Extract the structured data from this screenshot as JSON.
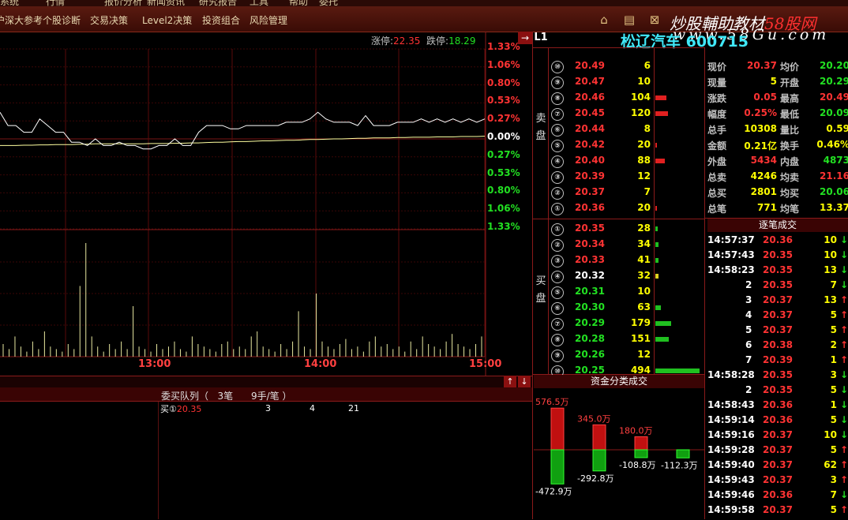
{
  "menu_top": [
    "系统",
    "行情",
    "报价分析",
    "新闻资讯",
    "研究报告",
    "工具",
    "帮助",
    "委托"
  ],
  "menu": [
    "沪深大参考",
    "个股诊断",
    "交易决策",
    "Level2决策",
    "投资组合",
    "风险管理"
  ],
  "watermark": {
    "text_a": "炒股輔助教材",
    "text_b": "58股网",
    "url": "www.58Gu.com"
  },
  "stock_name": "松辽汽车 600715",
  "limits": {
    "up_label": "涨停:",
    "up": "22.35",
    "down_label": "跌停:",
    "down": "18.29"
  },
  "buttons": {
    "arrow": "→",
    "l1": "L1",
    "up": "↑",
    "down": "↓"
  },
  "pct_axis": [
    {
      "v": "1.33%",
      "c": "r"
    },
    {
      "v": "1.06%",
      "c": "r"
    },
    {
      "v": "0.80%",
      "c": "r"
    },
    {
      "v": "0.53%",
      "c": "r"
    },
    {
      "v": "0.27%",
      "c": "r"
    },
    {
      "v": "0.00%",
      "c": "w"
    },
    {
      "v": "0.27%",
      "c": "g"
    },
    {
      "v": "0.53%",
      "c": "g"
    },
    {
      "v": "0.80%",
      "c": "g"
    },
    {
      "v": "1.06%",
      "c": "g"
    },
    {
      "v": "1.33%",
      "c": "g"
    }
  ],
  "time_labels": [
    "13:00",
    "14:00",
    "15:00"
  ],
  "intraday_chart": {
    "price": [
      20.4,
      20.36,
      20.36,
      20.34,
      20.34,
      20.38,
      20.36,
      20.34,
      20.34,
      20.31,
      20.31,
      20.3,
      20.32,
      20.3,
      20.3,
      20.31,
      20.3,
      20.3,
      20.29,
      20.29,
      20.3,
      20.3,
      20.32,
      20.3,
      20.3,
      20.34,
      20.36,
      20.36,
      20.36,
      20.35,
      20.35,
      20.36,
      20.36,
      20.36,
      20.36,
      20.36,
      20.37,
      20.37,
      20.37,
      20.38,
      20.4,
      20.38,
      20.37,
      20.37,
      20.37,
      20.36,
      20.39,
      20.36,
      20.36,
      20.36,
      20.37,
      20.37,
      20.37,
      20.38,
      20.37,
      20.38,
      20.37,
      20.38,
      20.37,
      20.38,
      20.37,
      20.38
    ],
    "avg": [
      20.3,
      20.3,
      20.3,
      20.301,
      20.301,
      20.302,
      20.302,
      20.303,
      20.303,
      20.303,
      20.304,
      20.304,
      20.305,
      20.305,
      20.305,
      20.305,
      20.305,
      20.305,
      20.305,
      20.306,
      20.306,
      20.306,
      20.307,
      20.307,
      20.308,
      20.308,
      20.309,
      20.31,
      20.31,
      20.311,
      20.312,
      20.312,
      20.313,
      20.314,
      20.314,
      20.315,
      20.316,
      20.316,
      20.317,
      20.318,
      20.318,
      20.319,
      20.32,
      20.32,
      20.321,
      20.322,
      20.322,
      20.323,
      20.323,
      20.323,
      20.324,
      20.324,
      20.325,
      20.325,
      20.325,
      20.326,
      20.326,
      20.326,
      20.327,
      20.327,
      20.327,
      20.328
    ],
    "volume": [
      5,
      3,
      8,
      4,
      2,
      6,
      3,
      10,
      4,
      3,
      2,
      5,
      3,
      28,
      45,
      8,
      4,
      2,
      5,
      3,
      6,
      3,
      20,
      4,
      3,
      2,
      5,
      3,
      4,
      6,
      3,
      2,
      8,
      5,
      4,
      3,
      2,
      5,
      6,
      3,
      4,
      3,
      8,
      10,
      4,
      3,
      2,
      5,
      3,
      6,
      18,
      4,
      3,
      25,
      6,
      4,
      3,
      5,
      7,
      3,
      4,
      2,
      6,
      8,
      4,
      5,
      3,
      4,
      2,
      6,
      3,
      8,
      5,
      4,
      3,
      6,
      9,
      5,
      4,
      3,
      5,
      8
    ]
  },
  "sell_label": "卖盘",
  "buy_label": "买盘",
  "sell_book": [
    {
      "n": "⑩",
      "p": "20.49",
      "q": "6",
      "bar": 0
    },
    {
      "n": "⑨",
      "p": "20.47",
      "q": "10",
      "bar": 0
    },
    {
      "n": "⑧",
      "p": "20.46",
      "q": "104",
      "bar": 14
    },
    {
      "n": "⑦",
      "p": "20.45",
      "q": "120",
      "bar": 16
    },
    {
      "n": "⑥",
      "p": "20.44",
      "q": "8",
      "bar": 0
    },
    {
      "n": "⑤",
      "p": "20.42",
      "q": "20",
      "bar": 2
    },
    {
      "n": "④",
      "p": "20.40",
      "q": "88",
      "bar": 12
    },
    {
      "n": "③",
      "p": "20.39",
      "q": "12",
      "bar": 0
    },
    {
      "n": "②",
      "p": "20.37",
      "q": "7",
      "bar": 0
    },
    {
      "n": "①",
      "p": "20.36",
      "q": "20",
      "bar": 2
    }
  ],
  "buy_book": [
    {
      "n": "①",
      "p": "20.35",
      "q": "28",
      "bar": 3,
      "pc": "r"
    },
    {
      "n": "②",
      "p": "20.34",
      "q": "34",
      "bar": 4,
      "pc": "r"
    },
    {
      "n": "③",
      "p": "20.33",
      "q": "41",
      "bar": 4,
      "pc": "r"
    },
    {
      "n": "④",
      "p": "20.32",
      "q": "32",
      "bar": 4,
      "pc": "w",
      "yellow": true
    },
    {
      "n": "⑤",
      "p": "20.31",
      "q": "10",
      "bar": 0,
      "pc": "g"
    },
    {
      "n": "⑥",
      "p": "20.30",
      "q": "63",
      "bar": 7,
      "pc": "g"
    },
    {
      "n": "⑦",
      "p": "20.29",
      "q": "179",
      "bar": 20,
      "pc": "g"
    },
    {
      "n": "⑧",
      "p": "20.28",
      "q": "151",
      "bar": 17,
      "pc": "g"
    },
    {
      "n": "⑨",
      "p": "20.26",
      "q": "12",
      "bar": 0,
      "pc": "g"
    },
    {
      "n": "⑩",
      "p": "20.25",
      "q": "494",
      "bar": 56,
      "pc": "g"
    }
  ],
  "quote": [
    {
      "l": "现价",
      "v": "20.37",
      "vc": "r",
      "l2": "均价",
      "v2": "20.20",
      "v2c": "g"
    },
    {
      "l": "现量",
      "v": "5",
      "vc": "y",
      "l2": "开盘",
      "v2": "20.29",
      "v2c": "g"
    },
    {
      "l": "涨跌",
      "v": "0.05",
      "vc": "r",
      "l2": "最高",
      "v2": "20.49",
      "v2c": "r"
    },
    {
      "l": "幅度",
      "v": "0.25%",
      "vc": "r",
      "l2": "最低",
      "v2": "20.09",
      "v2c": "g"
    },
    {
      "l": "总手",
      "v": "10308",
      "vc": "y",
      "l2": "量比",
      "v2": "0.59",
      "v2c": "y"
    },
    {
      "l": "金额",
      "v": "0.21亿",
      "vc": "y",
      "l2": "换手",
      "v2": "0.46%",
      "v2c": "y"
    },
    {
      "l": "外盘",
      "v": "5434",
      "vc": "r",
      "l2": "内盘",
      "v2": "4873",
      "v2c": "g"
    },
    {
      "l": "总卖",
      "v": "4246",
      "vc": "y",
      "l2": "均卖",
      "v2": "21.16",
      "v2c": "r"
    },
    {
      "l": "总买",
      "v": "2801",
      "vc": "y",
      "l2": "均买",
      "v2": "20.06",
      "v2c": "g"
    },
    {
      "l": "总笔",
      "v": "771",
      "vc": "y",
      "l2": "均笔",
      "v2": "13.37",
      "v2c": "y"
    }
  ],
  "ticks_title": "逐笔成交",
  "ticks": [
    {
      "t": "14:57:37",
      "p": "20.36",
      "v": "10",
      "d": "↓",
      "dc": "g"
    },
    {
      "t": "14:57:43",
      "p": "20.35",
      "v": "10",
      "d": "↓",
      "dc": "g"
    },
    {
      "t": "14:58:23",
      "p": "20.35",
      "v": "13",
      "d": "↓",
      "dc": "g"
    },
    {
      "t": "2",
      "p": "20.35",
      "v": "7",
      "d": "↓",
      "dc": "g"
    },
    {
      "t": "3",
      "p": "20.37",
      "v": "13",
      "d": "↑",
      "dc": "r"
    },
    {
      "t": "4",
      "p": "20.37",
      "v": "5",
      "d": "↑",
      "dc": "r"
    },
    {
      "t": "5",
      "p": "20.37",
      "v": "5",
      "d": "↑",
      "dc": "r"
    },
    {
      "t": "6",
      "p": "20.38",
      "v": "2",
      "d": "↑",
      "dc": "r"
    },
    {
      "t": "7",
      "p": "20.39",
      "v": "1",
      "d": "↑",
      "dc": "r"
    },
    {
      "t": "14:58:28",
      "p": "20.35",
      "v": "3",
      "d": "↓",
      "dc": "g"
    },
    {
      "t": "2",
      "p": "20.35",
      "v": "5",
      "d": "↓",
      "dc": "g"
    },
    {
      "t": "14:58:43",
      "p": "20.36",
      "v": "1",
      "d": "↓",
      "dc": "g"
    },
    {
      "t": "14:59:14",
      "p": "20.36",
      "v": "5",
      "d": "↓",
      "dc": "g"
    },
    {
      "t": "14:59:16",
      "p": "20.37",
      "v": "10",
      "d": "↓",
      "dc": "g"
    },
    {
      "t": "14:59:28",
      "p": "20.37",
      "v": "5",
      "d": "↑",
      "dc": "r"
    },
    {
      "t": "14:59:40",
      "p": "20.37",
      "v": "62",
      "d": "↑",
      "dc": "r"
    },
    {
      "t": "14:59:43",
      "p": "20.37",
      "v": "3",
      "d": "↑",
      "dc": "r"
    },
    {
      "t": "14:59:46",
      "p": "20.36",
      "v": "7",
      "d": "↓",
      "dc": "g"
    },
    {
      "t": "14:59:58",
      "p": "20.37",
      "v": "5",
      "d": "↑",
      "dc": "r"
    }
  ],
  "queue": {
    "title": "委买队列（   3笔      9手/笔 ）",
    "row_label": "买①",
    "row_price": "20.35",
    "vals": [
      "3",
      "4",
      "21"
    ]
  },
  "fund_title": "资金分类成交",
  "fund_flow": [
    {
      "in": 576.5,
      "out": -472.9,
      "in_label": "576.5万",
      "out_label": "-472.9万"
    },
    {
      "in": 345.0,
      "out": -292.8,
      "in_label": "345.0万",
      "out_label": "-292.8万"
    },
    {
      "in": 180.0,
      "out": -108.8,
      "in_label": "180.0万",
      "out_label": "-108.8万"
    },
    {
      "in": 0,
      "out": -112.3,
      "in_label": "",
      "out_label": "-112.3万"
    }
  ]
}
